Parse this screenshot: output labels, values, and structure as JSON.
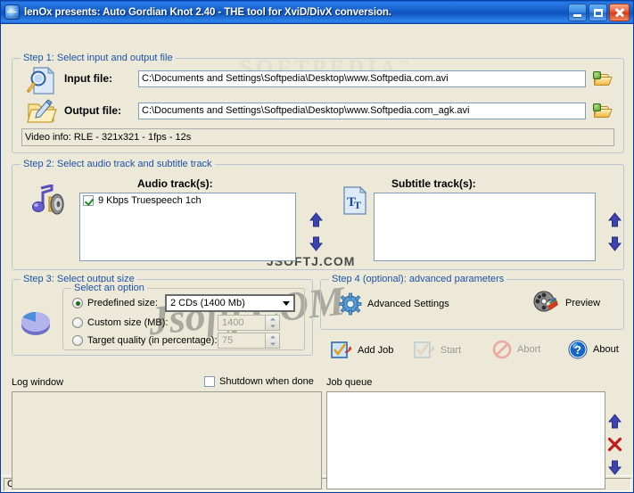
{
  "window": {
    "title": "lenOx presents: Auto Gordian Knot 2.40  -  THE tool for XviD/DivX conversion.",
    "app_icon": "globe-icon",
    "minimize_label": "Minimize",
    "maximize_label": "Maximize",
    "close_label": "Close"
  },
  "watermarks": {
    "softpedia": "SOFTPEDIA",
    "softpedia_tm": "™",
    "jsoftj_upper": "JSOFTJ.COM",
    "jsoftj_script": "Jsoftj.COM"
  },
  "step1": {
    "legend": "Step 1: Select input and output file",
    "input_label": "Input file:",
    "input_value": "C:\\Documents and Settings\\Softpedia\\Desktop\\www.Softpedia.com.avi",
    "input_placeholder": "",
    "output_label": "Output file:",
    "output_value": "C:\\Documents and Settings\\Softpedia\\Desktop\\www.Softpedia.com_agk.avi",
    "output_placeholder": "",
    "browse_label": "Browse",
    "video_info": "Video info:   RLE - 321x321 - 1fps - 12s"
  },
  "step2": {
    "legend": "Step 2: Select audio track and subtitle track",
    "audio_heading": "Audio track(s):",
    "subtitle_heading": "Subtitle track(s):",
    "audio_tracks": [
      {
        "label": "9 Kbps Truespeech 1ch",
        "checked": true
      }
    ],
    "subtitle_tracks": [],
    "move_up_label": "Move up",
    "move_down_label": "Move down"
  },
  "step3": {
    "legend": "Step 3: Select output size",
    "inner_legend": "Select an option",
    "options": [
      {
        "label": "Predefined size:",
        "selected": true
      },
      {
        "label": "Custom size (MB):",
        "selected": false
      },
      {
        "label": "Target quality (in percentage):",
        "selected": false
      }
    ],
    "predefined_value": "2 CDs (1400 Mb)",
    "custom_size_value": "1400",
    "target_quality_value": "75"
  },
  "step4": {
    "legend_main": "Step 4 (optional):",
    "legend_rest": " advanced parameters",
    "advanced_settings_label": "Advanced Settings",
    "preview_label": "Preview"
  },
  "actions": [
    {
      "label": "Add Job",
      "icon": "add-job-icon",
      "enabled": true
    },
    {
      "label": "Start",
      "icon": "start-icon",
      "enabled": false
    },
    {
      "label": "Abort",
      "icon": "abort-icon",
      "enabled": false
    },
    {
      "label": "About",
      "icon": "about-icon",
      "enabled": true
    }
  ],
  "bottom": {
    "log_label": "Log window",
    "shutdown_label": "Shutdown when done",
    "shutdown_checked": false,
    "job_queue_label": "Job queue",
    "log_text": "",
    "job_queue_items": [],
    "queue_up_label": "Move job up",
    "queue_delete_label": "Delete job",
    "queue_down_label": "Move job down"
  },
  "statusbar": {
    "text": "Codec: XviD -  Audio: Auto -  Auto width - .AVI format"
  },
  "colors": {
    "title_blue": "#1760cc",
    "legend_blue": "#1c52a8",
    "face": "#ece9d8",
    "field_border": "#7f9db9",
    "arrow_blue": "#3b44b0",
    "delete_red": "#c01d1d"
  }
}
